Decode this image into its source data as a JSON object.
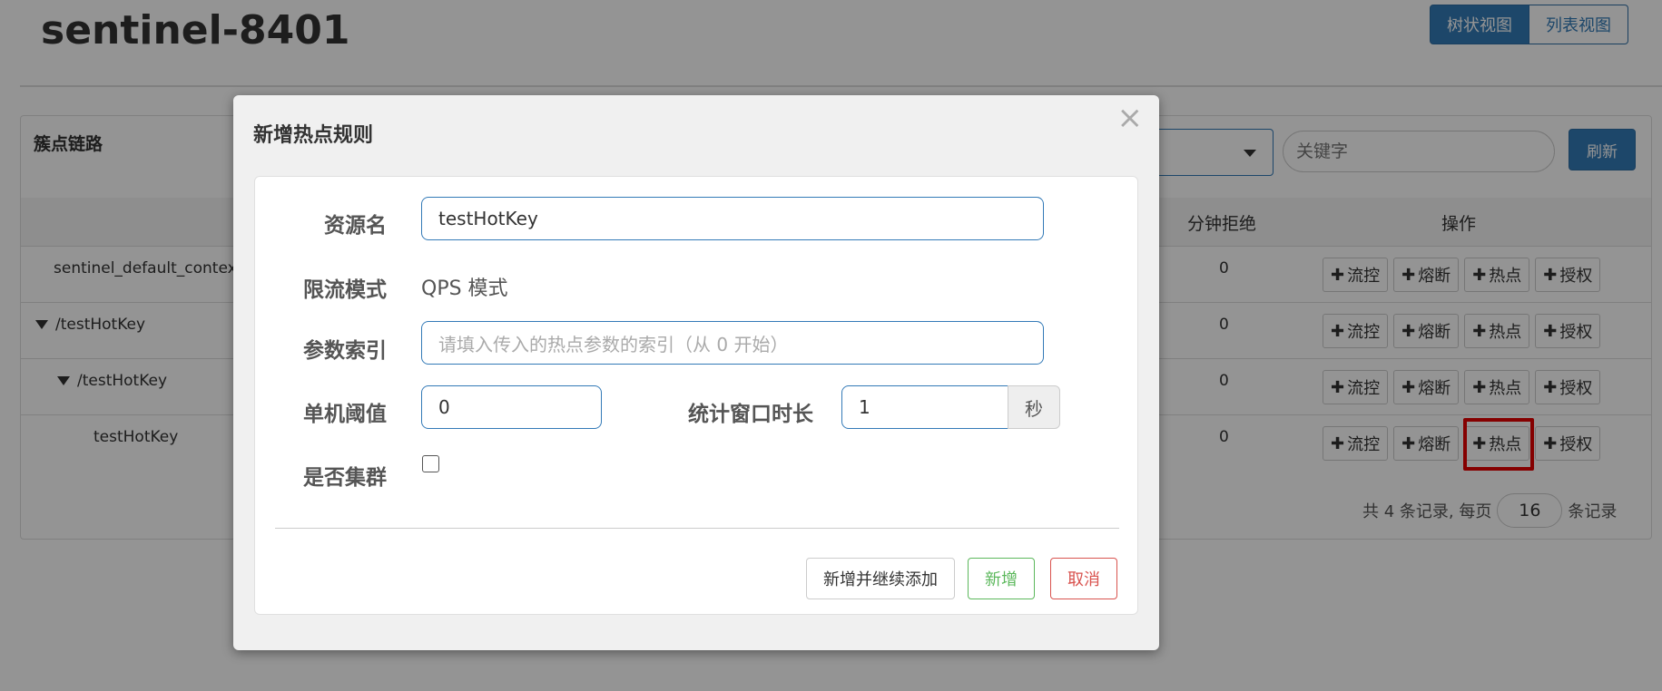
{
  "page": {
    "title": "sentinel-8401",
    "view_tabs": [
      "树状视图",
      "列表视图"
    ]
  },
  "panel": {
    "title": "簇点链路",
    "keyword_placeholder": "关键字",
    "refresh_label": "刷新",
    "columns": {
      "block_qps": "分钟拒绝",
      "ops": "操作"
    },
    "rows": [
      {
        "name": "sentinel_default_context",
        "expandable": false,
        "block": "0"
      },
      {
        "name": "/testHotKey",
        "expandable": true,
        "block": "0"
      },
      {
        "name": "/testHotKey",
        "expandable": true,
        "block": "0"
      },
      {
        "name": "testHotKey",
        "expandable": false,
        "block": "0"
      }
    ],
    "op_buttons": [
      "流控",
      "熔断",
      "热点",
      "授权"
    ],
    "pager": {
      "prefix": "共 4 条记录, 每页",
      "size": "16",
      "suffix": "条记录"
    }
  },
  "modal": {
    "title": "新增热点规则",
    "close_glyph": "×",
    "fields": {
      "resource_label": "资源名",
      "resource_value": "testHotKey",
      "mode_label": "限流模式",
      "mode_value": "QPS 模式",
      "param_label": "参数索引",
      "param_placeholder": "请填入传入的热点参数的索引（从 0 开始）",
      "threshold_label": "单机阈值",
      "threshold_value": "0",
      "window_label": "统计窗口时长",
      "window_value": "1",
      "window_unit": "秒",
      "cluster_label": "是否集群",
      "cluster_checked": false
    },
    "buttons": {
      "save_continue": "新增并继续添加",
      "save": "新增",
      "cancel": "取消"
    }
  },
  "colors": {
    "primary": "#337ab7",
    "success": "#5cb85c",
    "danger": "#d9534f",
    "highlight": "#e60000"
  }
}
